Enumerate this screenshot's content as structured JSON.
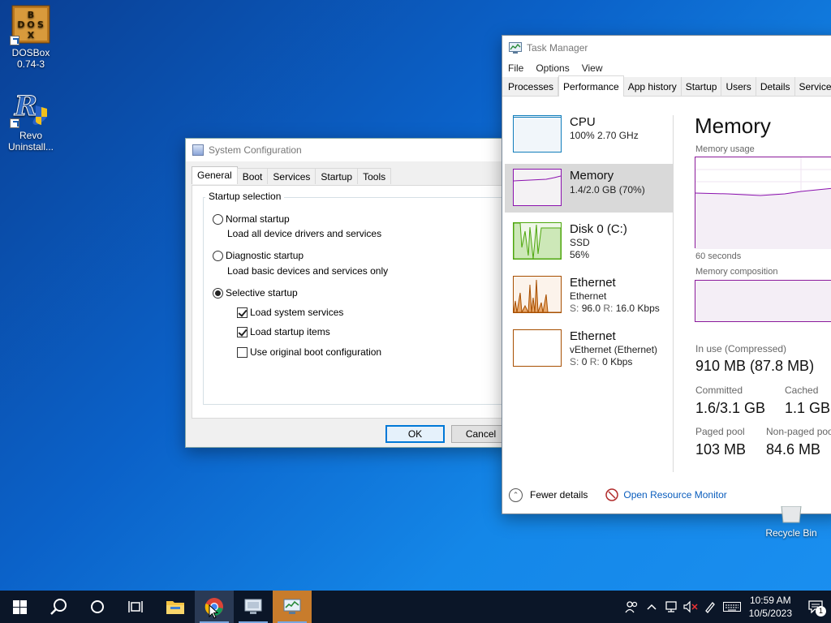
{
  "desktop": {
    "icons": [
      {
        "label_line1": "DOSBox",
        "label_line2": "0.74-3",
        "icon": "dosbox-icon"
      },
      {
        "label_line1": "Revo",
        "label_line2": "Uninstall...",
        "icon": "revo-icon"
      }
    ],
    "recycle_bin": "Recycle Bin"
  },
  "msconfig": {
    "title": "System Configuration",
    "tabs": [
      "General",
      "Boot",
      "Services",
      "Startup",
      "Tools"
    ],
    "active_tab": "General",
    "group_title": "Startup selection",
    "normal": {
      "label": "Normal startup",
      "desc": "Load all device drivers and services",
      "selected": false
    },
    "diagnostic": {
      "label": "Diagnostic startup",
      "desc": "Load basic devices and services only",
      "selected": false
    },
    "selective": {
      "label": "Selective startup",
      "selected": true
    },
    "checks": [
      {
        "label": "Load system services",
        "checked": true
      },
      {
        "label": "Load startup items",
        "checked": true
      },
      {
        "label": "Use original boot configuration",
        "checked": false
      }
    ],
    "ok": "OK",
    "cancel": "Cancel"
  },
  "taskmgr": {
    "title": "Task Manager",
    "menu": [
      "File",
      "Options",
      "View"
    ],
    "tabs": [
      "Processes",
      "Performance",
      "App history",
      "Startup",
      "Users",
      "Details",
      "Services"
    ],
    "active_tab": "Performance",
    "sidebar": [
      {
        "title": "CPU",
        "line1": "100% 2.70 GHz",
        "line2": ""
      },
      {
        "title": "Memory",
        "line1": "1.4/2.0 GB (70%)",
        "line2": ""
      },
      {
        "title": "Disk 0 (C:)",
        "line1": "SSD",
        "line2": "56%"
      },
      {
        "title": "Ethernet",
        "line1": "Ethernet",
        "line2_s": "S:",
        "line2_sv": "96.0",
        "line2_r": "R:",
        "line2_rv": "16.0 Kbps"
      },
      {
        "title": "Ethernet",
        "line1": "vEthernet (Ethernet)",
        "line2_s": "S:",
        "line2_sv": "0",
        "line2_r": "R:",
        "line2_rv": "0 Kbps"
      }
    ],
    "detail": {
      "title": "Memory",
      "usage_label": "Memory usage",
      "seconds_label": "60 seconds",
      "composition_label": "Memory composition",
      "in_use_label": "In use (Compressed)",
      "in_use_value": "910 MB (87.8 MB)",
      "committed_label": "Committed",
      "committed_value": "1.6/3.1 GB",
      "cached_label": "Cached",
      "cached_value": "1.1 GB",
      "paged_label": "Paged pool",
      "paged_value": "103 MB",
      "nonpaged_label": "Non-paged poo",
      "nonpaged_value": "84.6 MB"
    },
    "fewer_details": "Fewer details",
    "resource_monitor": "Open Resource Monitor",
    "colors": {
      "cpu": "#117dbb",
      "memory": "#8b12ae",
      "disk": "#4da60c",
      "ethernet": "#a74f01"
    }
  },
  "taskbar": {
    "time": "10:59 AM",
    "date": "10/5/2023",
    "notifications": "1"
  }
}
